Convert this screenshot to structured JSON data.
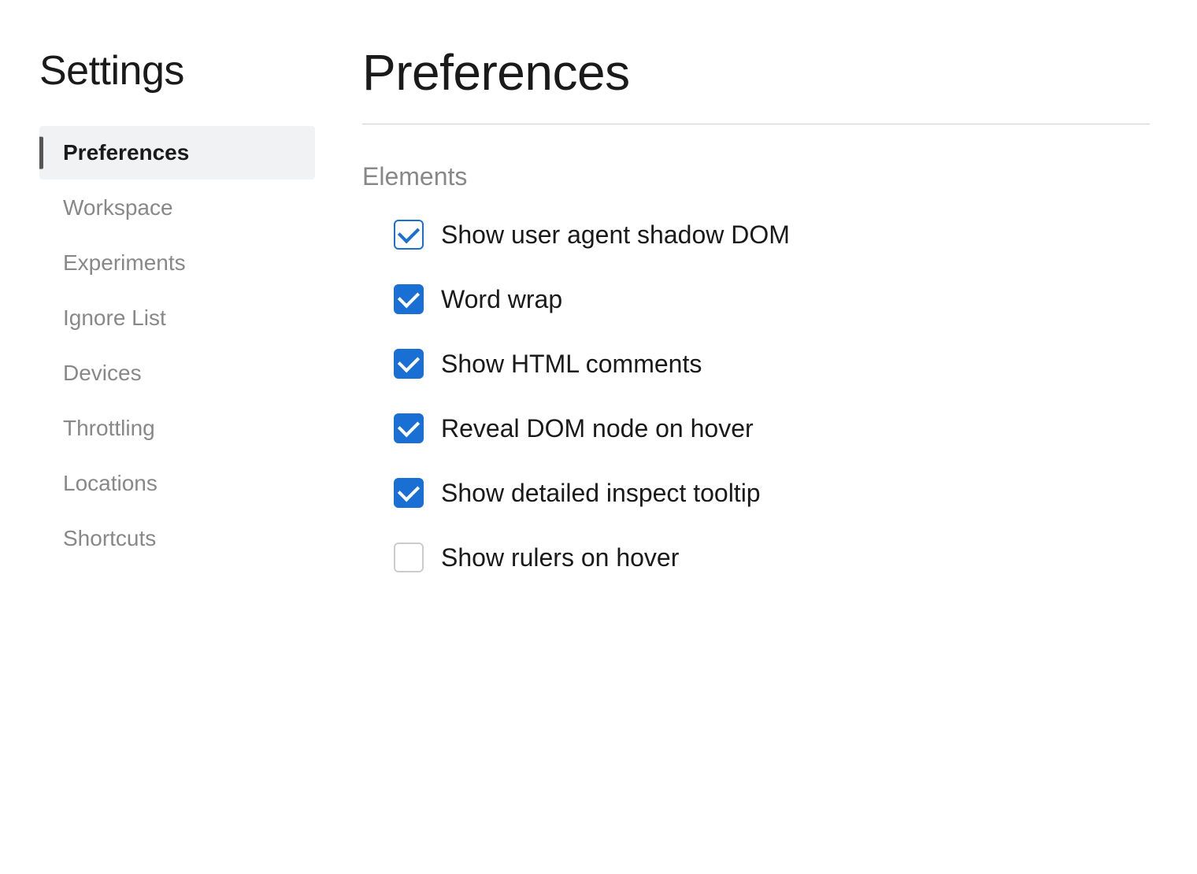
{
  "sidebar": {
    "title": "Settings",
    "nav_items": [
      {
        "id": "preferences",
        "label": "Preferences",
        "active": true
      },
      {
        "id": "workspace",
        "label": "Workspace",
        "active": false
      },
      {
        "id": "experiments",
        "label": "Experiments",
        "active": false
      },
      {
        "id": "ignore-list",
        "label": "Ignore List",
        "active": false
      },
      {
        "id": "devices",
        "label": "Devices",
        "active": false
      },
      {
        "id": "throttling",
        "label": "Throttling",
        "active": false
      },
      {
        "id": "locations",
        "label": "Locations",
        "active": false
      },
      {
        "id": "shortcuts",
        "label": "Shortcuts",
        "active": false
      }
    ]
  },
  "main": {
    "page_title": "Preferences",
    "section_title": "Elements",
    "checkboxes": [
      {
        "id": "shadow-dom",
        "label": "Show user agent shadow DOM",
        "checked": true,
        "style": "outline"
      },
      {
        "id": "word-wrap",
        "label": "Word wrap",
        "checked": true,
        "style": "filled"
      },
      {
        "id": "html-comments",
        "label": "Show HTML comments",
        "checked": true,
        "style": "filled"
      },
      {
        "id": "dom-hover",
        "label": "Reveal DOM node on hover",
        "checked": true,
        "style": "filled"
      },
      {
        "id": "inspect-tooltip",
        "label": "Show detailed inspect tooltip",
        "checked": true,
        "style": "filled"
      },
      {
        "id": "rulers-hover",
        "label": "Show rulers on hover",
        "checked": false,
        "style": "unchecked"
      }
    ]
  }
}
